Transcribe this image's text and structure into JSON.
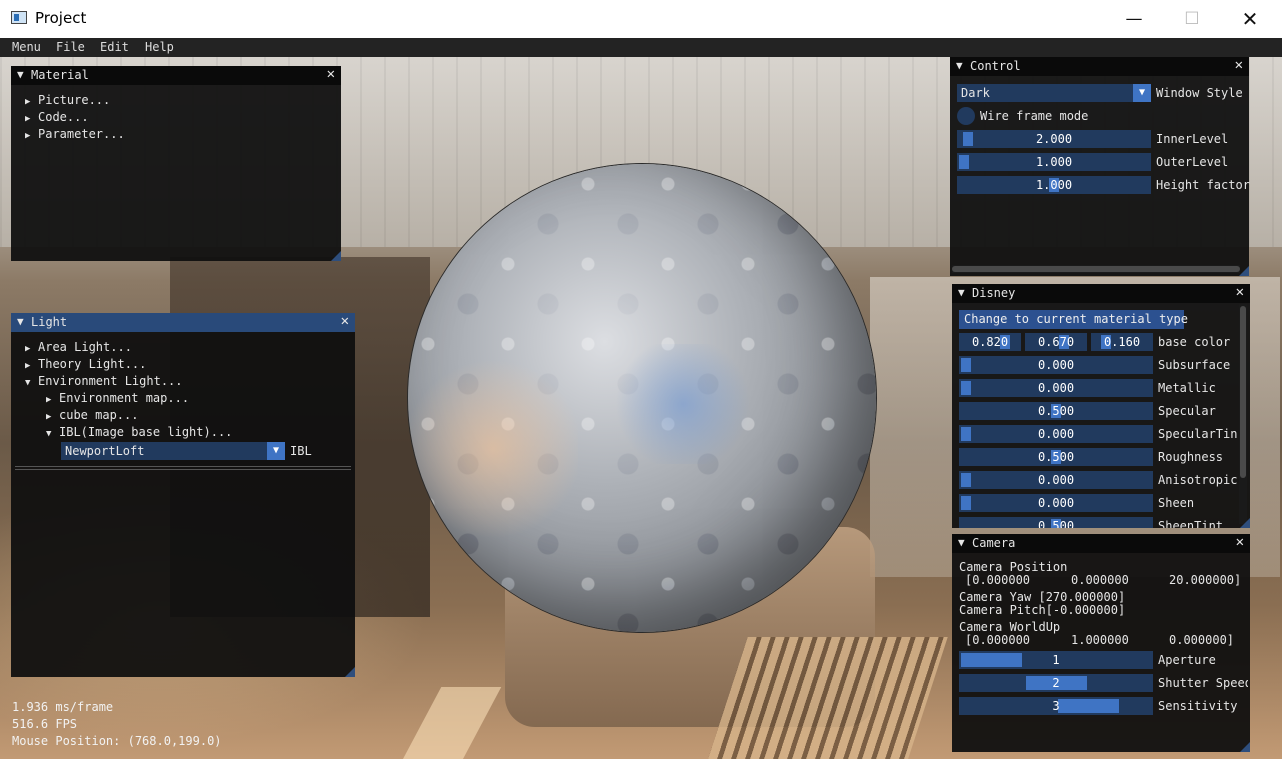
{
  "window": {
    "title": "Project"
  },
  "titlebar_buttons": {
    "minimize": "—",
    "maximize": "☐",
    "close": "✕"
  },
  "menubar": [
    "Menu",
    "File",
    "Edit",
    "Help"
  ],
  "material_panel": {
    "title": "Material",
    "items": [
      "Picture...",
      "Code...",
      "Parameter..."
    ]
  },
  "light_panel": {
    "title": "Light",
    "items": [
      "Area Light...",
      "Theory Light...",
      "Environment Light..."
    ],
    "env_items": [
      "Environment map...",
      "cube map...",
      "IBL(Image base light)..."
    ],
    "ibl_value": "NewportLoft",
    "ibl_label": "IBL"
  },
  "control_panel": {
    "title": "Control",
    "style_value": "Dark",
    "style_label": "Window Style",
    "wireframe_label": "Wire frame mode",
    "inner_value": "2.000",
    "inner_label": "InnerLevel",
    "inner_frac": 0.02,
    "outer_value": "1.000",
    "outer_label": "OuterLevel",
    "outer_frac": 0.0,
    "height_value": "1.000",
    "height_label": "Height factor",
    "height_frac": 0.5
  },
  "disney_panel": {
    "title": "Disney",
    "change_button": "Change to current material type",
    "base_color": [
      "0.820",
      "0.670",
      "0.160"
    ],
    "base_color_frac": [
      0.82,
      0.67,
      0.16
    ],
    "base_color_label": "base color",
    "params": [
      {
        "label": "Subsurface",
        "value": "0.000",
        "frac": 0.0
      },
      {
        "label": "Metallic",
        "value": "0.000",
        "frac": 0.0
      },
      {
        "label": "Specular",
        "value": "0.500",
        "frac": 0.5
      },
      {
        "label": "SpecularTint",
        "value": "0.000",
        "frac": 0.0
      },
      {
        "label": "Roughness",
        "value": "0.500",
        "frac": 0.5
      },
      {
        "label": "Anisotropic",
        "value": "0.000",
        "frac": 0.0
      },
      {
        "label": "Sheen",
        "value": "0.000",
        "frac": 0.0
      },
      {
        "label": "SheenTint",
        "value": "0.500",
        "frac": 0.5
      }
    ]
  },
  "camera_panel": {
    "title": "Camera",
    "position_label": "Camera Position",
    "position_values": [
      "[0.000000",
      "0.000000",
      "20.000000]"
    ],
    "yaw": "Camera Yaw [270.000000]",
    "pitch": "Camera Pitch[-0.000000]",
    "worldup_label": "Camera WorldUp",
    "worldup_values": [
      "[0.000000",
      "1.000000",
      "0.000000]"
    ],
    "aperture_value": "1",
    "aperture_label": "Aperture",
    "aperture_frac": 0.0,
    "shutter_value": "2",
    "shutter_label": "Shutter Speed",
    "shutter_frac": 0.5,
    "sensitivity_value": "3",
    "sensitivity_label": "Sensitivity",
    "sensitivity_frac": 0.75
  },
  "stats": {
    "frame_time": "1.936 ms/frame",
    "fps": "516.6 FPS",
    "mouse": "Mouse Position: (768.0,199.0)"
  },
  "colors": {
    "accent": "#3f74c4",
    "frame_bg": "#213a5e",
    "title_active": "#294a7a"
  },
  "icons": {
    "expand": "▼",
    "collapsed": "▶",
    "close": "✕"
  }
}
